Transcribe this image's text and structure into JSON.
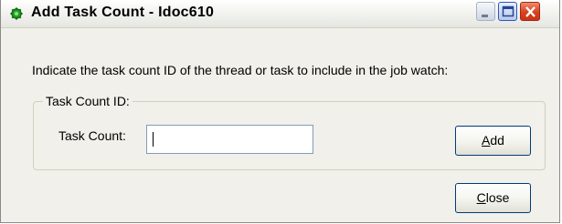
{
  "window": {
    "title": "Add Task Count - Idoc610",
    "icon": "green-gear-icon",
    "controls": {
      "minimize": "minimize-icon",
      "maximize": "maximize-icon",
      "close": "close-icon"
    }
  },
  "dialog": {
    "instruction": "Indicate the task count ID of the thread or task to include in the job watch:",
    "group_title": "Task Count ID:",
    "field_label": "Task Count:",
    "field_value": "",
    "add_button": {
      "mnemonic": "A",
      "rest": "dd"
    },
    "close_button": {
      "mnemonic": "C",
      "rest": "lose"
    }
  },
  "colors": {
    "dialog_bg": "#f1f0ea",
    "close_red": "#d9421f",
    "button_border": "#003c74"
  }
}
